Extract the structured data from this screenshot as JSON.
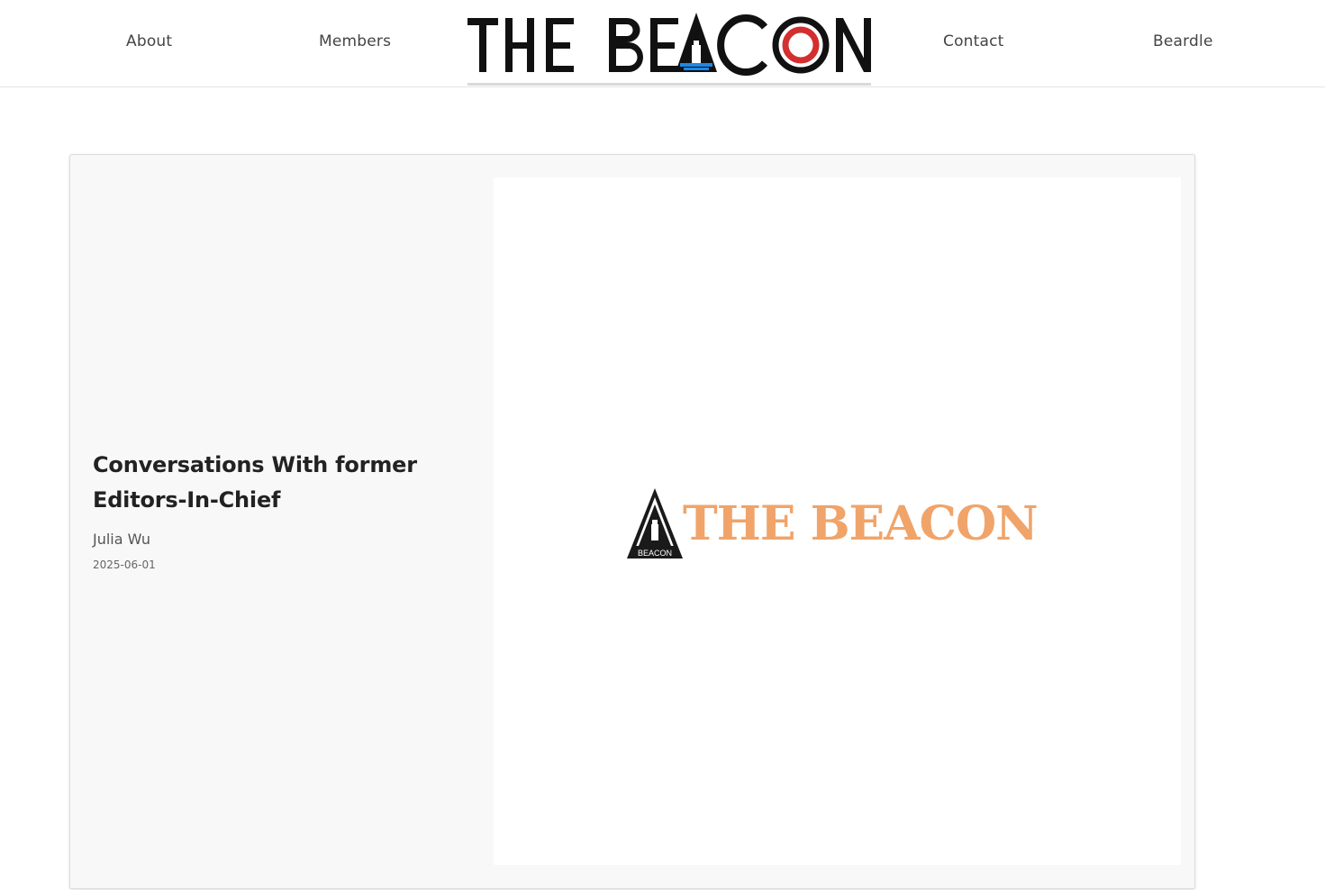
{
  "nav": {
    "about": "About",
    "members": "Members",
    "contact": "Contact",
    "beardle": "Beardle"
  },
  "logo": {
    "text": "THE BEACON",
    "accent_color": "#d32f2f",
    "lighthouse_color": "#1e88e5"
  },
  "article": {
    "title": "Conversations With former Editors-In-Chief",
    "author": "Julia Wu",
    "date": "2025-06-01",
    "image": {
      "logo_text": "THE BEACON",
      "badge_text": "BEACON",
      "text_color": "#f0a46a"
    }
  }
}
